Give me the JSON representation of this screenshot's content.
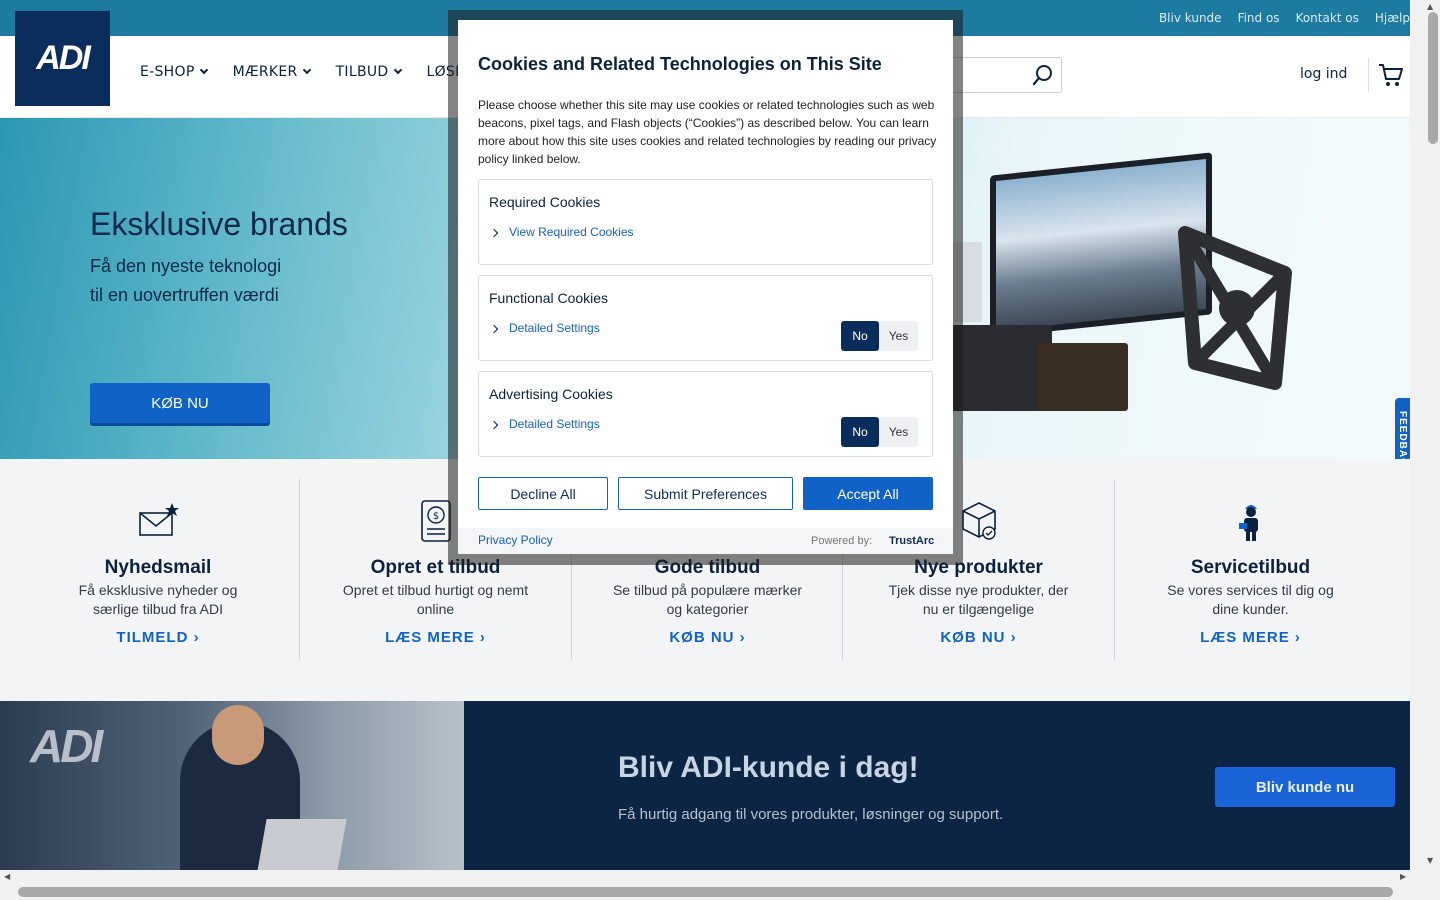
{
  "util_links": [
    "Bliv kunde",
    "Find os",
    "Kontakt os",
    "Hjælp"
  ],
  "logo": {
    "text": "ADI"
  },
  "nav": {
    "items": [
      {
        "label": "E-SHOP"
      },
      {
        "label": "MÆRKER"
      },
      {
        "label": "TILBUD"
      },
      {
        "label": "LØSI"
      }
    ]
  },
  "header": {
    "login": "log ind"
  },
  "hero": {
    "title": "Eksklusive brands",
    "subtitle_line1": "Få den nyeste teknologi",
    "subtitle_line2": "til en uovertruffen værdi",
    "cta": "KØB NU"
  },
  "feedback_tab": "FEEDBACK",
  "features": [
    {
      "icon": "mail-star-icon",
      "title": "Nyhedsmail",
      "desc": "Få eksklusive nyheder og særlige tilbud fra ADI",
      "link": "TILMELD ›"
    },
    {
      "icon": "quote-document-icon",
      "title": "Opret et tilbud",
      "desc": "Opret et tilbud hurtigt og nemt online",
      "link": "LÆS MERE ›"
    },
    {
      "icon": "tag-icon",
      "title": "Gode tilbud",
      "desc": "Se tilbud på populære mærker og kategorier",
      "link": "KØB NU ›"
    },
    {
      "icon": "box-check-icon",
      "title": "Nye produkter",
      "desc": "Tjek disse nye produkter, der nu er tilgængelige",
      "link": "KØB NU ›"
    },
    {
      "icon": "technician-icon",
      "title": "Servicetilbud",
      "desc": "Se vores services til dig og dine kunder.",
      "link": "LÆS MERE ›"
    }
  ],
  "banner": {
    "logo_text": "ADI",
    "headline": "Bliv ADI-kunde i dag!",
    "sub": "Få hurtig adgang til vores produkter, løsninger og support.",
    "cta": "Bliv kunde nu"
  },
  "cookie_modal": {
    "title": "Cookies and Related Technologies on This Site",
    "intro": "Please choose whether this site may use cookies or related technologies such as web beacons, pixel tags, and Flash objects (“Cookies”) as described below. You can learn more about how this site uses cookies and related technologies by reading our privacy policy linked below.",
    "sections": [
      {
        "title": "Required Cookies",
        "link": "View Required Cookies"
      },
      {
        "title": "Functional Cookies",
        "link": "Detailed Settings",
        "no": "No",
        "yes": "Yes",
        "selected": "No"
      },
      {
        "title": "Advertising Cookies",
        "link": "Detailed Settings",
        "no": "No",
        "yes": "Yes",
        "selected": "No"
      }
    ],
    "buttons": {
      "decline": "Decline All",
      "submit": "Submit Preferences",
      "accept": "Accept All"
    },
    "footer": {
      "privacy": "Privacy Policy",
      "powered_by": "Powered by:",
      "brand": "TrustArc"
    }
  },
  "colors": {
    "brand_navy": "#0b2d5b",
    "accent_blue": "#1162c7",
    "util_bar": "#1d7aa0"
  }
}
